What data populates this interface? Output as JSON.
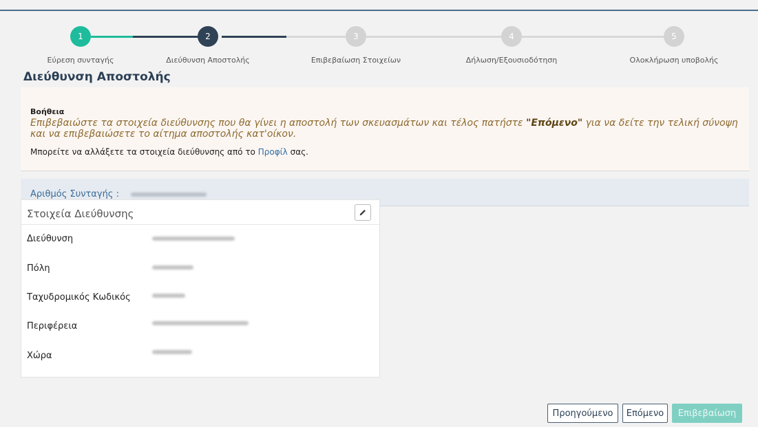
{
  "stepper": {
    "steps": [
      {
        "number": "1",
        "label": "Εύρεση συνταγής",
        "state": "completed"
      },
      {
        "number": "2",
        "label": "Διεύθυνση Αποστολής",
        "state": "active"
      },
      {
        "number": "3",
        "label": "Επιβεβαίωση Στοιχείων",
        "state": "pending"
      },
      {
        "number": "4",
        "label": "Δήλωση/Εξουσιοδότηση",
        "state": "pending"
      },
      {
        "number": "5",
        "label": "Ολοκλήρωση υποβολής",
        "state": "pending"
      }
    ],
    "colors": {
      "completed": "#1ebc9c",
      "active": "#2f4256",
      "pending": "#d3d3d3"
    }
  },
  "page": {
    "title": "Διεύθυνση Αποστολής"
  },
  "help": {
    "title": "Βοήθεια",
    "text_before": "Επιβεβαιώστε τα στοιχεία διεύθυνσης που θα γίνει η αποστολή των σκευασμάτων και τέλος πατήστε ",
    "text_bold": "\"Επόμενο\"",
    "text_after": " για να δείτε την τελική σύνοψη και να επιβεβαιώσετε το αίτημα αποστολής κατ'οίκον.",
    "note_before": "Μπορείτε να αλλάξετε τα στοιχεία διεύθυνσης από το ",
    "note_link": "Προφίλ",
    "note_after": " σας."
  },
  "prescription": {
    "label": "Αριθμός Συνταγής :"
  },
  "address_card": {
    "title": "Στοιχεία Διεύθυνσης",
    "edit_icon": "pencil-icon",
    "fields": [
      {
        "label": "Διεύθυνση"
      },
      {
        "label": "Πόλη"
      },
      {
        "label": "Ταχυδρομικός Κωδικός"
      },
      {
        "label": "Περιφέρεια"
      },
      {
        "label": "Χώρα"
      }
    ]
  },
  "buttons": {
    "previous": "Προηγούμενο",
    "next": "Επόμενο",
    "confirm": "Επιβεβαίωση"
  }
}
